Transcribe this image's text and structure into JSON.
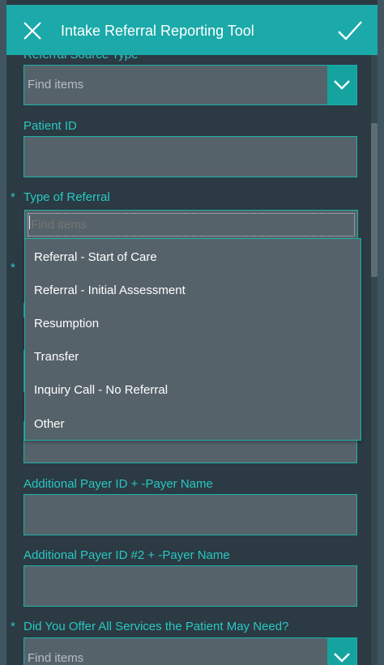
{
  "header": {
    "title": "Intake Referral Reporting Tool"
  },
  "form": {
    "referral_source_type": {
      "label": "Referral Source Type",
      "placeholder": "Find items"
    },
    "patient_id": {
      "label": "Patient ID"
    },
    "type_of_referral": {
      "required_mark": "*",
      "label": "Type of Referral",
      "search_placeholder": "Find items",
      "options": [
        "Referral - Start of Care",
        "Referral - Initial Assessment",
        "Resumption",
        "Transfer",
        "Inquiry Call - No Referral",
        "Other"
      ]
    },
    "hidden_required_mark": "*",
    "additional_payer_1": {
      "label": "Additional Payer ID + -Payer Name"
    },
    "additional_payer_2": {
      "label": "Additional Payer ID #2 + -Payer Name"
    },
    "services_offered": {
      "required_mark": "*",
      "label": "Did You Offer All Services the Patient May Need?",
      "placeholder": "Find items"
    }
  },
  "colors": {
    "accent": "#1ba9a9",
    "label": "#29c8c3",
    "field_bg": "#56626a",
    "page_bg": "#2b3a43"
  }
}
